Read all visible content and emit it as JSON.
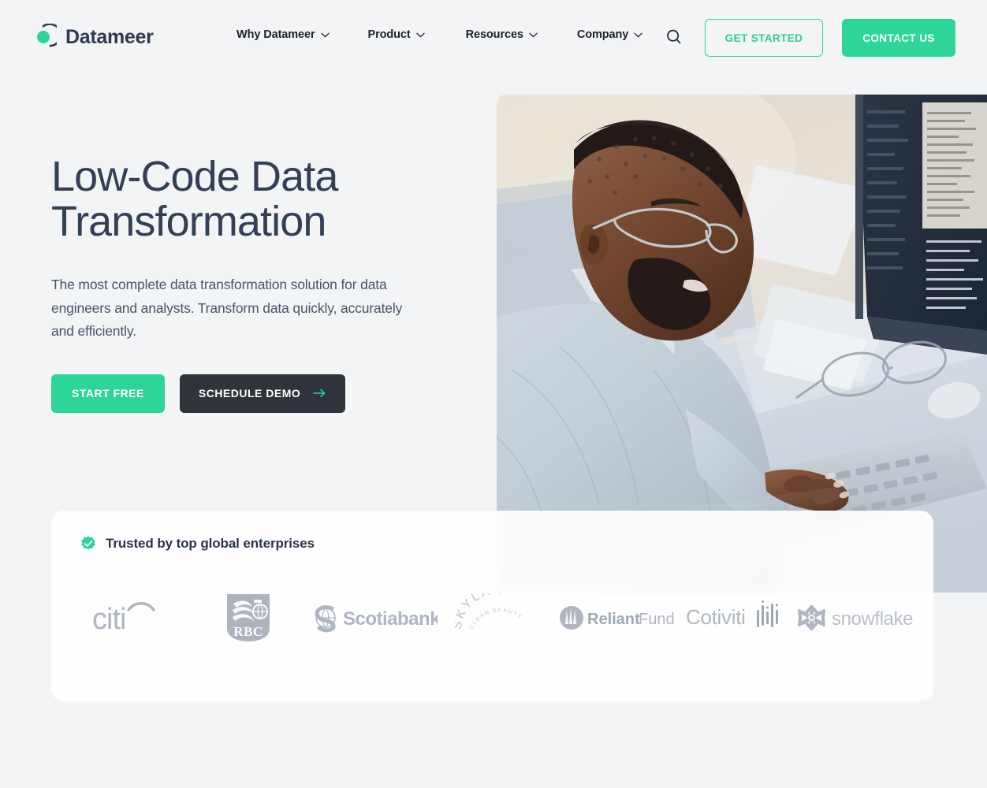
{
  "brand": {
    "name": "Datameer",
    "logo_icon": "datameer-ring-icon",
    "accent_green": "#2ed598",
    "dark_navy": "#2f3a4f"
  },
  "header": {
    "nav": [
      {
        "label": "Why Datameer",
        "icon": "chevron-down-icon"
      },
      {
        "label": "Product",
        "icon": "chevron-down-icon"
      },
      {
        "label": "Resources",
        "icon": "chevron-down-icon"
      },
      {
        "label": "Company",
        "icon": "chevron-down-icon"
      }
    ],
    "search_icon": "search-icon",
    "get_started_label": "GET STARTED",
    "contact_us_label": "CONTACT US"
  },
  "hero": {
    "headline": "Low-Code Data\nTransformation",
    "subhead": "The most complete data transformation solution for data engineers and analysts. Transform data quickly, accurately and efficiently.",
    "primary_cta": "START FREE",
    "secondary_cta": "SCHEDULE DEMO",
    "secondary_cta_icon": "arrow-right-icon",
    "image_alt": "developer-at-desk-photo"
  },
  "trust": {
    "badge_icon": "verified-check-badge-icon",
    "title": "Trusted by top global enterprises",
    "logos": [
      {
        "name": "citi",
        "icon": "citi-logo"
      },
      {
        "name": "RBC",
        "icon": "rbc-logo"
      },
      {
        "name": "Scotiabank",
        "icon": "scotiabank-logo"
      },
      {
        "name": "SKYLAR CLEAN BEAUTY",
        "icon": "skylar-logo"
      },
      {
        "name": "Reliant Funding",
        "icon": "reliant-funding-logo"
      },
      {
        "name": "Cotiviti",
        "icon": "cotiviti-logo"
      },
      {
        "name": "snowflake",
        "icon": "snowflake-logo"
      }
    ]
  }
}
